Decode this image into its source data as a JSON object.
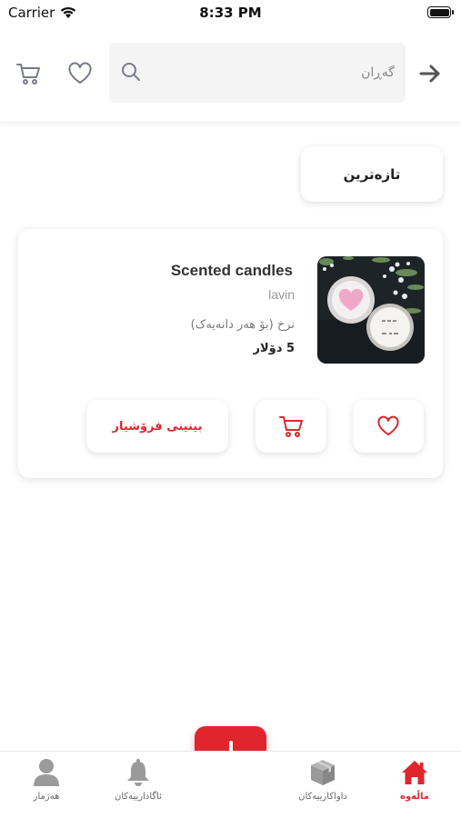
{
  "status_bar": {
    "carrier": "Carrier",
    "time": "8:33 PM"
  },
  "header": {
    "search_placeholder": "گەڕان",
    "icons": [
      "cart-icon",
      "heart-icon",
      "search-icon",
      "arrow-right-icon"
    ]
  },
  "filter": {
    "label": "تازەترین"
  },
  "product": {
    "title": "Scented candles",
    "seller": "lavin",
    "price_label": "نرخ (بۆ هەر دانەیەک)",
    "price_value": "5 دۆلار",
    "view_seller_label": "بینینی فرۆشیار",
    "image_icon": "candles-photo"
  },
  "bottom_nav": {
    "items": [
      {
        "label": "ماڵەوە",
        "icon": "home-icon",
        "active": true
      },
      {
        "label": "داواکارییەکان",
        "icon": "box-icon",
        "active": false
      },
      {
        "label": "ئاگادارییەکان",
        "icon": "bell-icon",
        "active": false
      },
      {
        "label": "هەژمار",
        "icon": "user-icon",
        "active": false
      }
    ],
    "fab_icon": "plus-icon"
  },
  "colors": {
    "accent": "#e0252c",
    "icon_gray": "#777c87",
    "nav_gray": "#9a9a9a",
    "background": "#ffffff",
    "search_bg": "#f4f4f5"
  }
}
